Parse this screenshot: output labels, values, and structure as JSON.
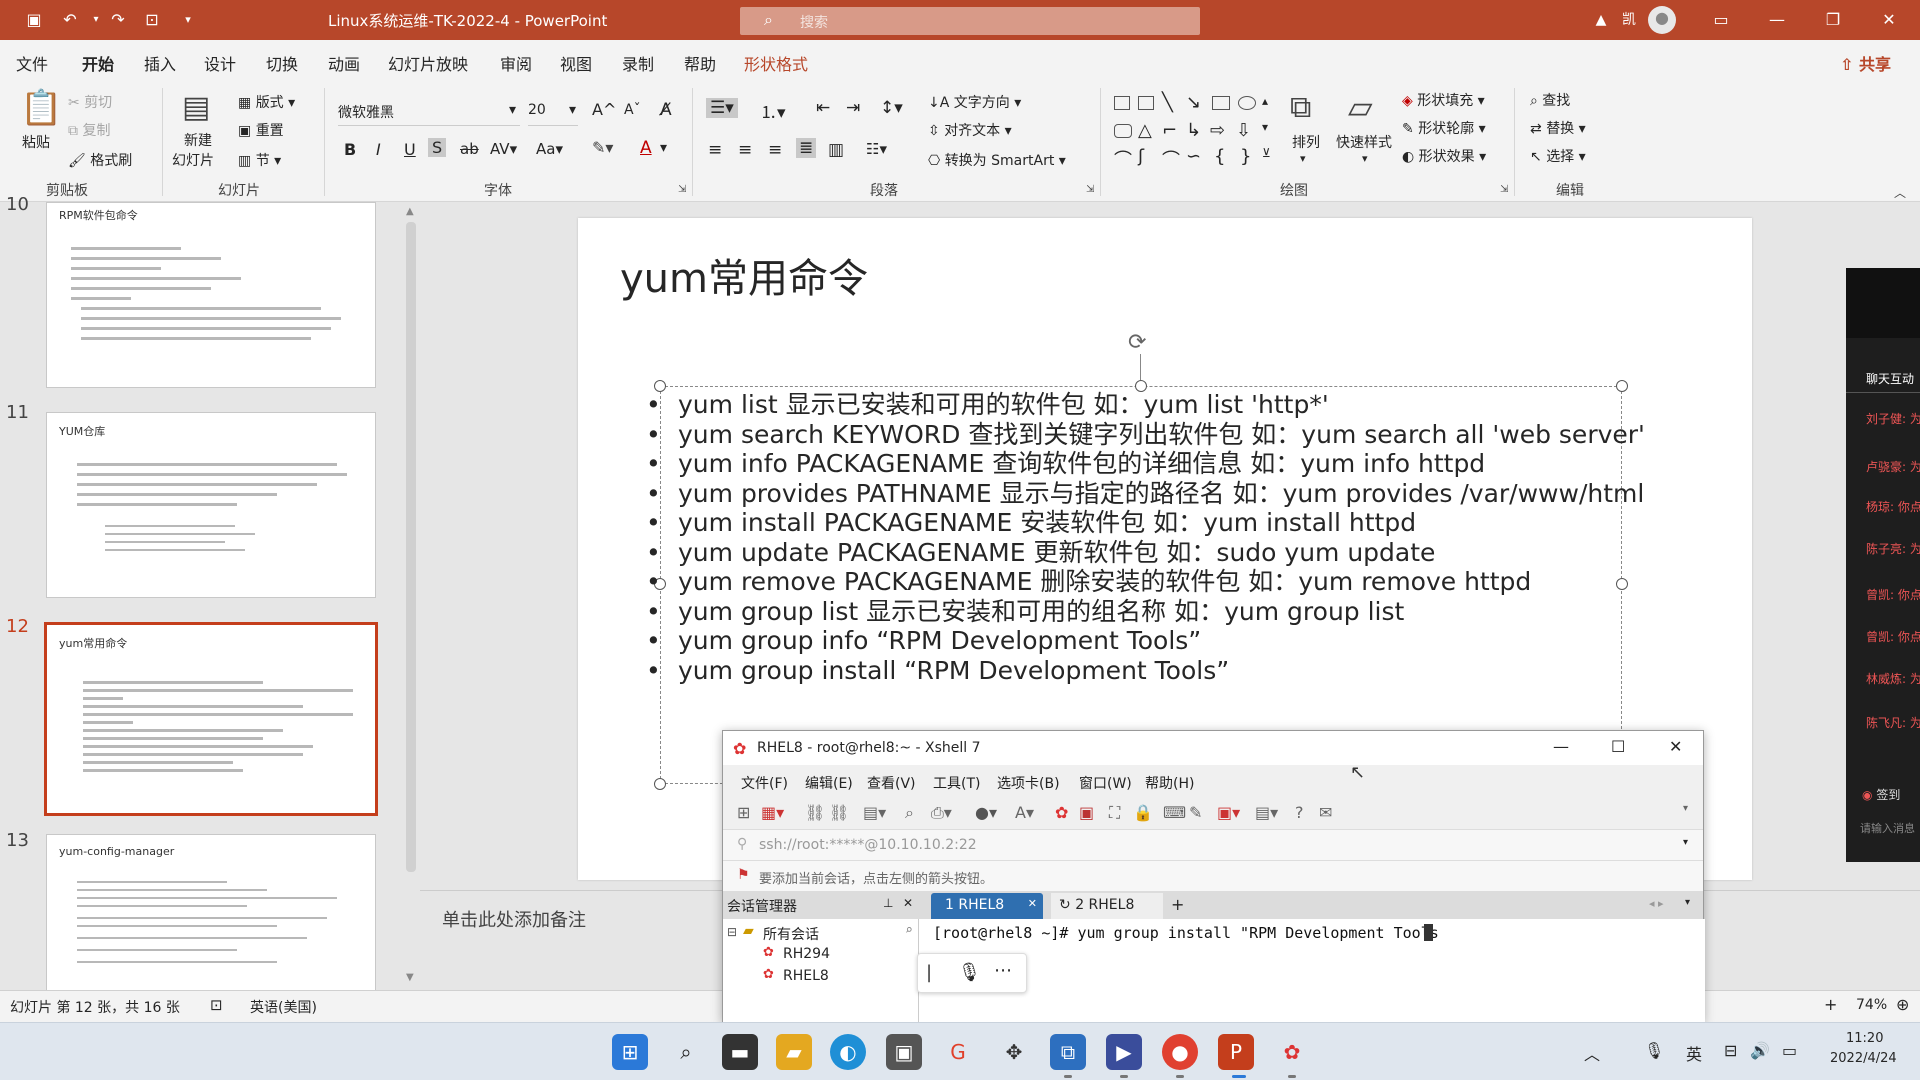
{
  "window": {
    "title": "Linux系统运维-TK-2022-4  -  PowerPoint",
    "search_placeholder": "搜索",
    "user_label": "凯"
  },
  "menu_tabs": [
    "文件",
    "开始",
    "插入",
    "设计",
    "切换",
    "动画",
    "幻灯片放映",
    "审阅",
    "视图",
    "录制",
    "帮助",
    "形状格式"
  ],
  "share_label": "共享",
  "ribbon": {
    "clipboard": {
      "paste": "粘贴",
      "cut": "剪切",
      "copy": "复制",
      "format_painter": "格式刷",
      "group": "剪贴板"
    },
    "slides": {
      "new_slide": "新建",
      "new_slide2": "幻灯片",
      "layout": "版式",
      "reset": "重置",
      "section": "节",
      "group": "幻灯片"
    },
    "font": {
      "family": "微软雅黑",
      "size": "20",
      "bold": "B",
      "italic": "I",
      "underline": "U",
      "shadow": "S",
      "strike": "ab",
      "spacing": "AV",
      "case": "Aa",
      "group": "字体"
    },
    "paragraph": {
      "text_direction": "文字方向",
      "align_text": "对齐文本",
      "smartart": "转换为 SmartArt",
      "group": "段落"
    },
    "drawing": {
      "arrange": "排列",
      "quick_styles": "快速样式",
      "shape_fill": "形状填充",
      "shape_outline": "形状轮廓",
      "shape_effects": "形状效果",
      "group": "绘图"
    },
    "editing": {
      "find": "查找",
      "replace": "替换",
      "select": "选择",
      "group": "编辑"
    }
  },
  "thumbnails": [
    {
      "num": "10",
      "title": "RPM软件包命令"
    },
    {
      "num": "11",
      "title": "YUM仓库"
    },
    {
      "num": "12",
      "title": "yum常用命令"
    },
    {
      "num": "13",
      "title": "yum-config-manager"
    }
  ],
  "slide": {
    "title": "yum常用命令",
    "bullets": [
      "yum list 显示已安装和可用的软件包  如：yum list 'http*'",
      "yum search KEYWORD 查找到关键字列出软件包  如：yum search all 'web server'",
      "yum info PACKAGENAME 查询软件包的详细信息 如：yum info httpd",
      "yum provides PATHNAME 显示与指定的路径名 如：yum provides /var/www/html",
      "yum install PACKAGENAME 安装软件包 如：yum install httpd",
      "yum update PACKAGENAME 更新软件包 如：sudo yum update",
      "yum remove PACKAGENAME 删除安装的软件包 如：yum remove httpd",
      "yum group list 显示已安装和可用的组名称 如：yum group list",
      "yum group info  “RPM Development Tools”",
      "yum group install  “RPM Development Tools”"
    ],
    "notes_placeholder": "单击此处添加备注"
  },
  "statusbar": {
    "slide_info": "幻灯片 第 12 张，共 16 张",
    "language": "英语(美国)",
    "zoom": "74%"
  },
  "xshell": {
    "title": "RHEL8 - root@rhel8:~ - Xshell 7",
    "menus": [
      "文件(F)",
      "编辑(E)",
      "查看(V)",
      "工具(T)",
      "选项卡(B)",
      "窗口(W)",
      "帮助(H)"
    ],
    "address": "ssh://root:*****@10.10.10.2:22",
    "hint": "要添加当前会话，点击左侧的箭头按钮。",
    "session_manager": "会话管理器",
    "tabs": [
      "1 RHEL8",
      "2 RHEL8"
    ],
    "tree_root": "所有会话",
    "tree_items": [
      "RH294",
      "RHEL8"
    ],
    "terminal_line": "[root@rhel8 ~]# yum group install \"RPM Development Tools"
  },
  "chat": {
    "header": "聊天互动",
    "rows": [
      "刘子健: 为你点赞!",
      "卢骁豪: 为你点赞!",
      "杨琼: 你点赞!",
      "陈子亮: 为你点赞!",
      "曾凯: 你点赞!",
      "曾凯: 你点赞!",
      "林威炼: 为你点赞!",
      "陈飞凡: 为你点赞!"
    ],
    "checkin": "签到",
    "input": "请输入消息"
  },
  "taskbar": {
    "ime": "英",
    "time": "11:20",
    "date": "2022/4/24"
  },
  "colors": {
    "brand": "#b7472a",
    "selection": "#c43e1c"
  }
}
